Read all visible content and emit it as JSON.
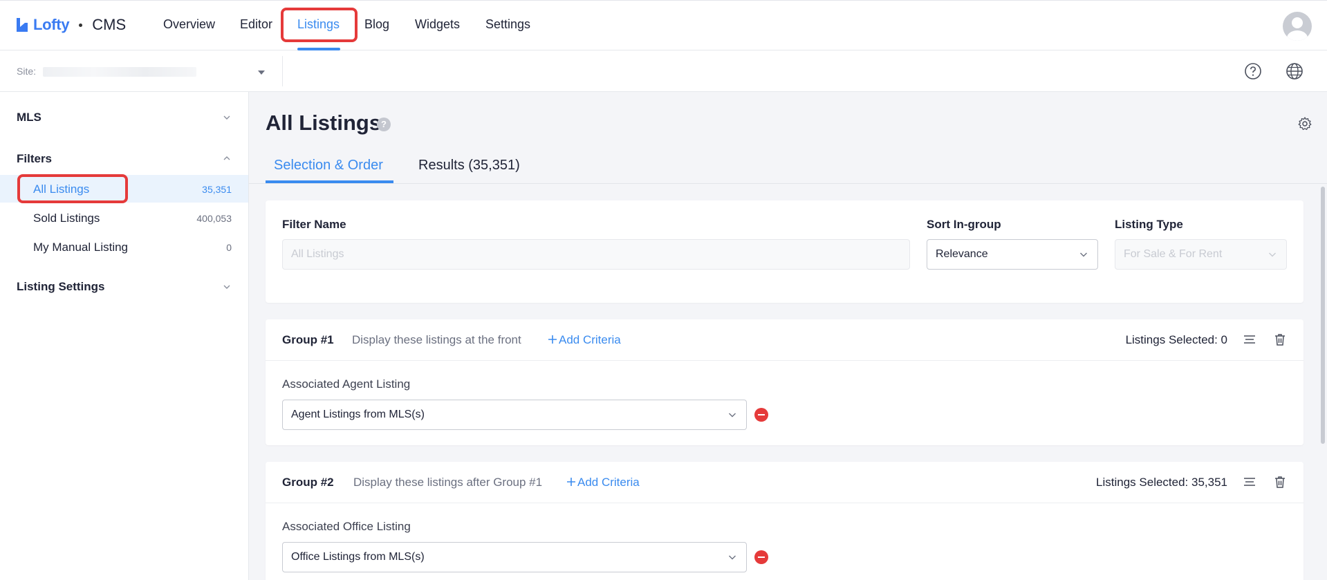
{
  "brand": {
    "name": "Lofty",
    "product": "CMS"
  },
  "nav": {
    "items": [
      {
        "label": "Overview"
      },
      {
        "label": "Editor"
      },
      {
        "label": "Listings"
      },
      {
        "label": "Blog"
      },
      {
        "label": "Widgets"
      },
      {
        "label": "Settings"
      }
    ],
    "active": "Listings"
  },
  "site": {
    "label": "Site:"
  },
  "sidebar": {
    "sections": [
      {
        "title": "MLS",
        "expanded": false
      },
      {
        "title": "Filters",
        "expanded": true
      },
      {
        "title": "Listing Settings",
        "expanded": false
      }
    ],
    "filters": [
      {
        "label": "All Listings",
        "count": "35,351",
        "active": true
      },
      {
        "label": "Sold Listings",
        "count": "400,053",
        "active": false
      },
      {
        "label": "My Manual Listing",
        "count": "0",
        "active": false
      }
    ]
  },
  "main": {
    "title": "All Listings",
    "help_glyph": "?",
    "tabs": [
      {
        "label": "Selection & Order",
        "active": true
      },
      {
        "label": "Results (35,351)",
        "active": false
      }
    ],
    "filter_form": {
      "filter_name_label": "Filter Name",
      "filter_name_placeholder": "All Listings",
      "sort_label": "Sort In-group",
      "sort_value": "Relevance",
      "type_label": "Listing Type",
      "type_value": "For Sale & For Rent"
    },
    "groups": [
      {
        "title": "Group #1",
        "description": "Display these listings at the front",
        "add_label": "Add Criteria",
        "selected": "Listings Selected: 0",
        "criteria_label": "Associated Agent Listing",
        "criteria_value": "Agent Listings from MLS(s)"
      },
      {
        "title": "Group #2",
        "description": "Display these listings after Group #1",
        "add_label": "Add Criteria",
        "selected": "Listings Selected: 35,351",
        "criteria_label": "Associated Office Listing",
        "criteria_value": "Office Listings from MLS(s)"
      }
    ]
  },
  "colors": {
    "accent": "#3a8bef",
    "highlight": "#e53a3a",
    "remove": "#e53a3a"
  },
  "icons": [
    "lofty-logo-icon",
    "avatar-icon",
    "help-circle-icon",
    "globe-icon",
    "gear-icon",
    "chevron-down-icon",
    "chevron-up-icon",
    "reorder-icon",
    "trash-icon",
    "remove-icon",
    "plus-icon"
  ]
}
